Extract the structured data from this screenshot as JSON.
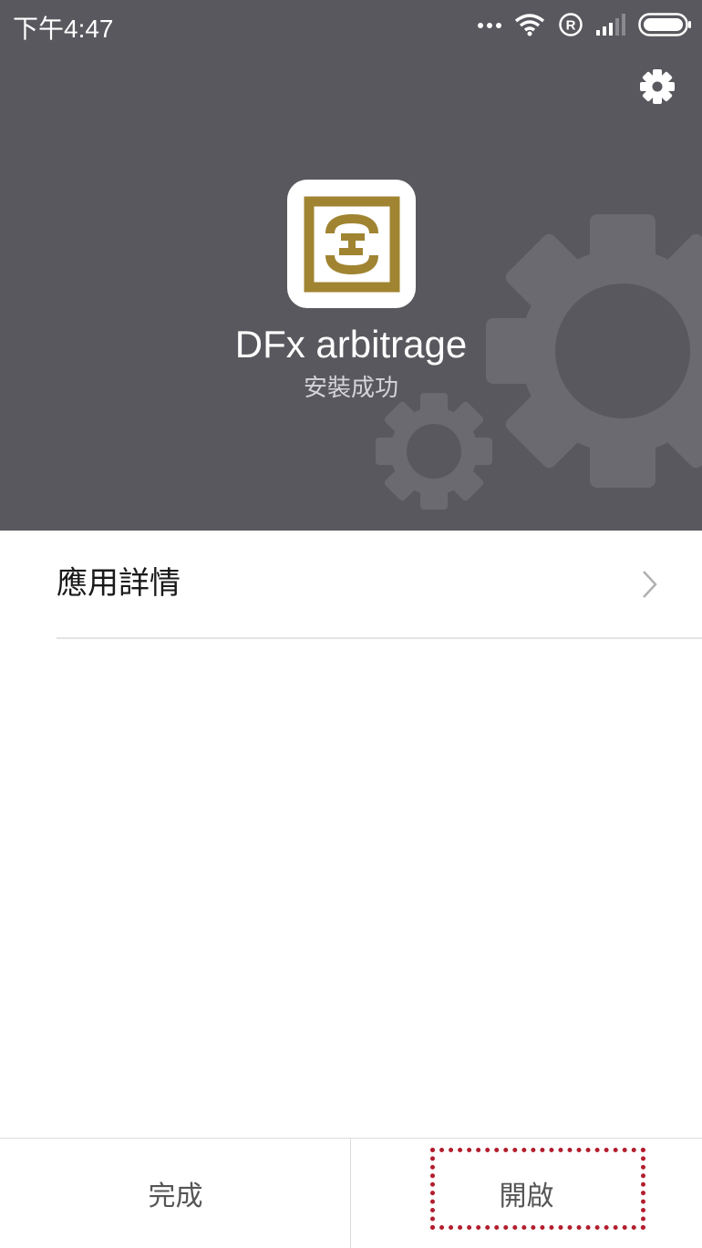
{
  "status_bar": {
    "time": "下午4:47",
    "icons": [
      "more-dots-icon",
      "wifi-icon",
      "registered-icon",
      "signal-icon",
      "battery-icon"
    ]
  },
  "header": {
    "settings_icon": "gear-icon",
    "app_name": "DFx arbitrage",
    "install_status": "安裝成功",
    "background_color": "#58585e"
  },
  "details": {
    "label": "應用詳情",
    "chevron_icon": "chevron-right-icon"
  },
  "bottom_bar": {
    "done_label": "完成",
    "open_label": "開啟"
  },
  "colors": {
    "icon_gold": "#a08431",
    "highlight": "#b21e2e"
  }
}
